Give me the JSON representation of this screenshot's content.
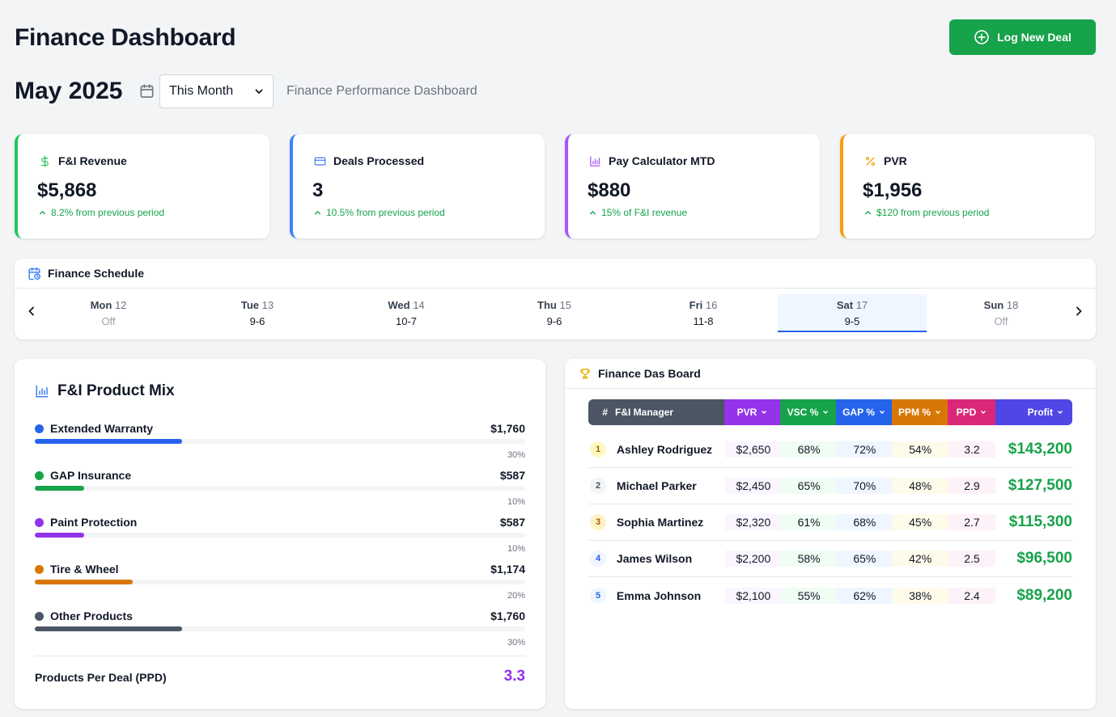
{
  "header": {
    "title": "Finance Dashboard",
    "log_button_label": "Log New Deal",
    "month": "May 2025",
    "period_selected": "This Month",
    "subtitle": "Finance Performance Dashboard"
  },
  "kpis": [
    {
      "label": "F&I Revenue",
      "value": "$5,868",
      "note": "8.2% from previous period",
      "icon": "dollar-icon",
      "color": "#22c55e"
    },
    {
      "label": "Deals Processed",
      "value": "3",
      "note": "10.5% from previous period",
      "icon": "credit-card-icon",
      "color": "#3b82f6"
    },
    {
      "label": "Pay Calculator MTD",
      "value": "$880",
      "note": "15% of F&I revenue",
      "icon": "bar-chart-icon",
      "color": "#a855f7"
    },
    {
      "label": "PVR",
      "value": "$1,956",
      "note": "$120 from previous period",
      "icon": "percent-icon",
      "color": "#f59e0b"
    }
  ],
  "schedule": {
    "title": "Finance Schedule",
    "days": [
      {
        "name": "Mon",
        "num": "12",
        "hours": "Off"
      },
      {
        "name": "Tue",
        "num": "13",
        "hours": "9-6"
      },
      {
        "name": "Wed",
        "num": "14",
        "hours": "10-7"
      },
      {
        "name": "Thu",
        "num": "15",
        "hours": "9-6"
      },
      {
        "name": "Fri",
        "num": "16",
        "hours": "11-8"
      },
      {
        "name": "Sat",
        "num": "17",
        "hours": "9-5"
      },
      {
        "name": "Sun",
        "num": "18",
        "hours": "Off"
      }
    ]
  },
  "product_mix": {
    "title": "F&I Product Mix",
    "items": [
      {
        "name": "Extended Warranty",
        "amount": "$1,760",
        "pct": "30%",
        "share": 0.3,
        "color": "#2563eb"
      },
      {
        "name": "GAP Insurance",
        "amount": "$587",
        "pct": "10%",
        "share": 0.1,
        "color": "#16a34a"
      },
      {
        "name": "Paint Protection",
        "amount": "$587",
        "pct": "10%",
        "share": 0.1,
        "color": "#9333ea"
      },
      {
        "name": "Tire & Wheel",
        "amount": "$1,174",
        "pct": "20%",
        "share": 0.2,
        "color": "#d97706"
      },
      {
        "name": "Other Products",
        "amount": "$1,760",
        "pct": "30%",
        "share": 0.3,
        "color": "#4b5563"
      }
    ],
    "ppd_label": "Products Per Deal (PPD)",
    "ppd_value": "3.3"
  },
  "board": {
    "title": "Finance Das Board",
    "columns": [
      "#",
      "F&I Manager",
      "PVR",
      "VSC %",
      "GAP %",
      "PPM %",
      "PPD",
      "Profit"
    ],
    "rows": [
      {
        "rank": "1",
        "name": "Ashley Rodriguez",
        "pvr": "$2,650",
        "vsc": "68%",
        "gap": "72%",
        "ppm": "54%",
        "ppd": "3.2",
        "profit": "$143,200"
      },
      {
        "rank": "2",
        "name": "Michael Parker",
        "pvr": "$2,450",
        "vsc": "65%",
        "gap": "70%",
        "ppm": "48%",
        "ppd": "2.9",
        "profit": "$127,500"
      },
      {
        "rank": "3",
        "name": "Sophia Martinez",
        "pvr": "$2,320",
        "vsc": "61%",
        "gap": "68%",
        "ppm": "45%",
        "ppd": "2.7",
        "profit": "$115,300"
      },
      {
        "rank": "4",
        "name": "James Wilson",
        "pvr": "$2,200",
        "vsc": "58%",
        "gap": "65%",
        "ppm": "42%",
        "ppd": "2.5",
        "profit": "$96,500"
      },
      {
        "rank": "5",
        "name": "Emma Johnson",
        "pvr": "$2,100",
        "vsc": "55%",
        "gap": "62%",
        "ppm": "38%",
        "ppd": "2.4",
        "profit": "$89,200"
      }
    ]
  }
}
